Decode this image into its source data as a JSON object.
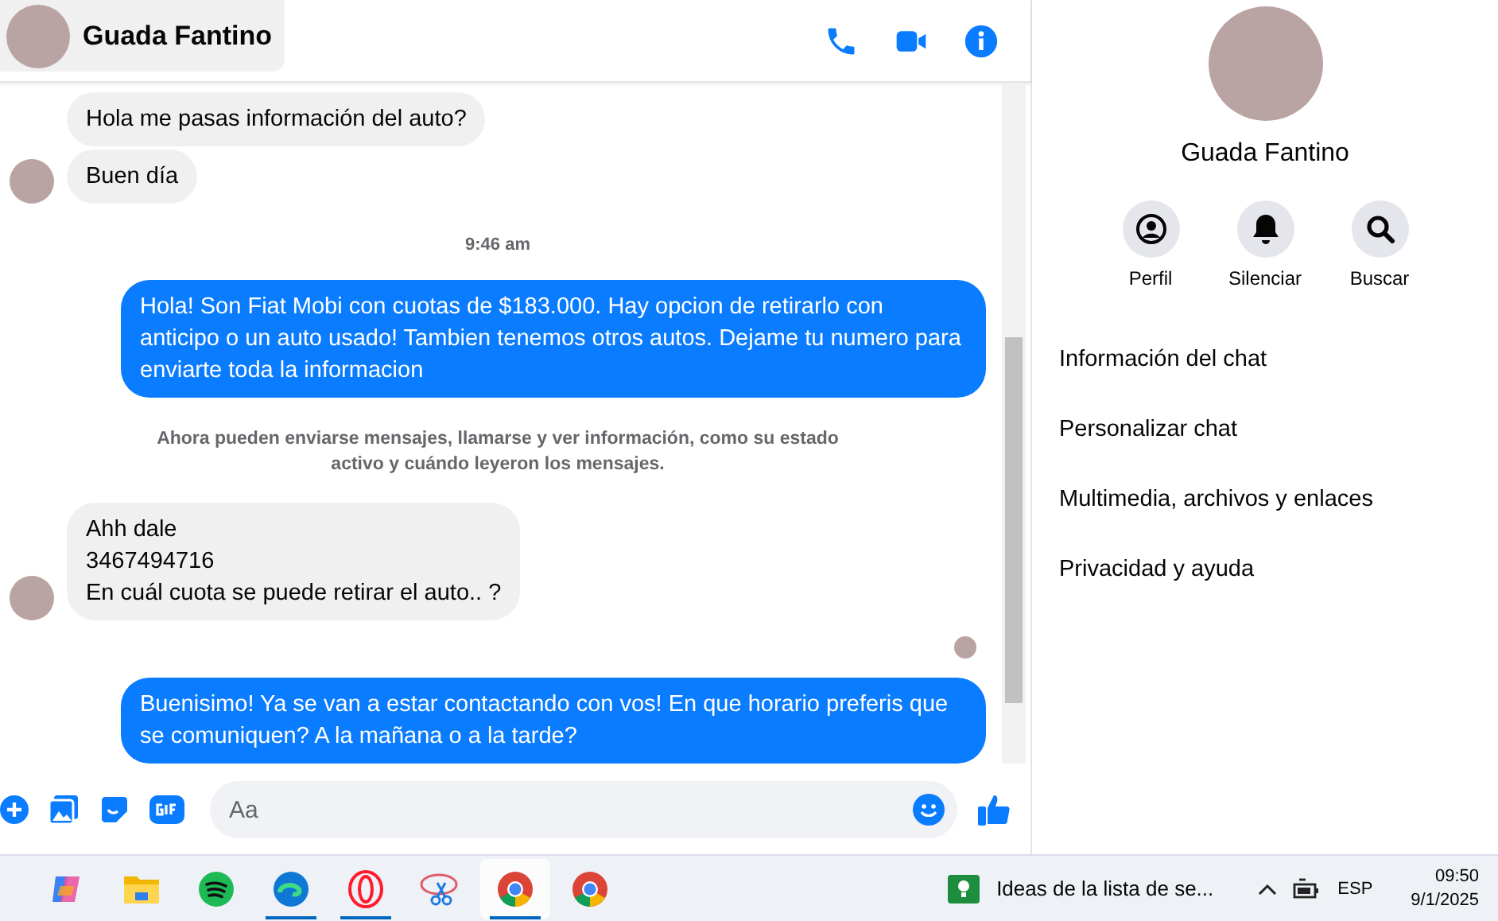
{
  "header": {
    "name": "Guada Fantino"
  },
  "messages": [
    {
      "kind": "incoming",
      "lines": [
        "Hola me pasas información del auto?"
      ],
      "avatar": false
    },
    {
      "kind": "incoming",
      "lines": [
        "Buen día"
      ],
      "avatar": true
    },
    {
      "kind": "time",
      "text": "9:46 am"
    },
    {
      "kind": "outgoing",
      "lines": [
        "Hola! Son Fiat Mobi con cuotas de $183.000. Hay opcion de retirarlo con anticipo o un auto usado! Tambien tenemos otros autos. Dejame tu numero para enviarte toda la informacion"
      ]
    },
    {
      "kind": "notice",
      "text": "Ahora pueden enviarse mensajes, llamarse y ver información, como su estado activo y cuándo leyeron los mensajes."
    },
    {
      "kind": "incoming",
      "lines": [
        "Ahh dale",
        "3467494716",
        "En cuál cuota se puede retirar el auto.. ?"
      ],
      "avatar": true
    },
    {
      "kind": "seen"
    },
    {
      "kind": "outgoing",
      "lines": [
        "Buenisimo! Ya se van a estar contactando con vos! En que horario preferis que se comuniquen? A la mañana o a la tarde?"
      ]
    }
  ],
  "composer": {
    "placeholder": "Aa"
  },
  "profile": {
    "name": "Guada Fantino",
    "actions": [
      {
        "kind": "profile",
        "label": "Perfil"
      },
      {
        "kind": "mute",
        "label": "Silenciar"
      },
      {
        "kind": "search",
        "label": "Buscar"
      }
    ],
    "sections": [
      "Información del chat",
      "Personalizar chat",
      "Multimedia, archivos y enlaces",
      "Privacidad y ayuda"
    ]
  },
  "taskbar": {
    "apps": [
      {
        "kind": "copilot",
        "running": false,
        "selected": false
      },
      {
        "kind": "folder",
        "running": false,
        "selected": false
      },
      {
        "kind": "spotify",
        "running": false,
        "selected": false
      },
      {
        "kind": "edge",
        "running": true,
        "selected": false
      },
      {
        "kind": "opera",
        "running": true,
        "selected": false
      },
      {
        "kind": "snip",
        "running": false,
        "selected": false
      },
      {
        "kind": "chrome",
        "running": true,
        "selected": true
      },
      {
        "kind": "chrome",
        "running": false,
        "selected": false
      }
    ],
    "widget": "Ideas de la lista de se...",
    "language": "ESP",
    "time": "09:50",
    "date": "9/1/2025"
  }
}
